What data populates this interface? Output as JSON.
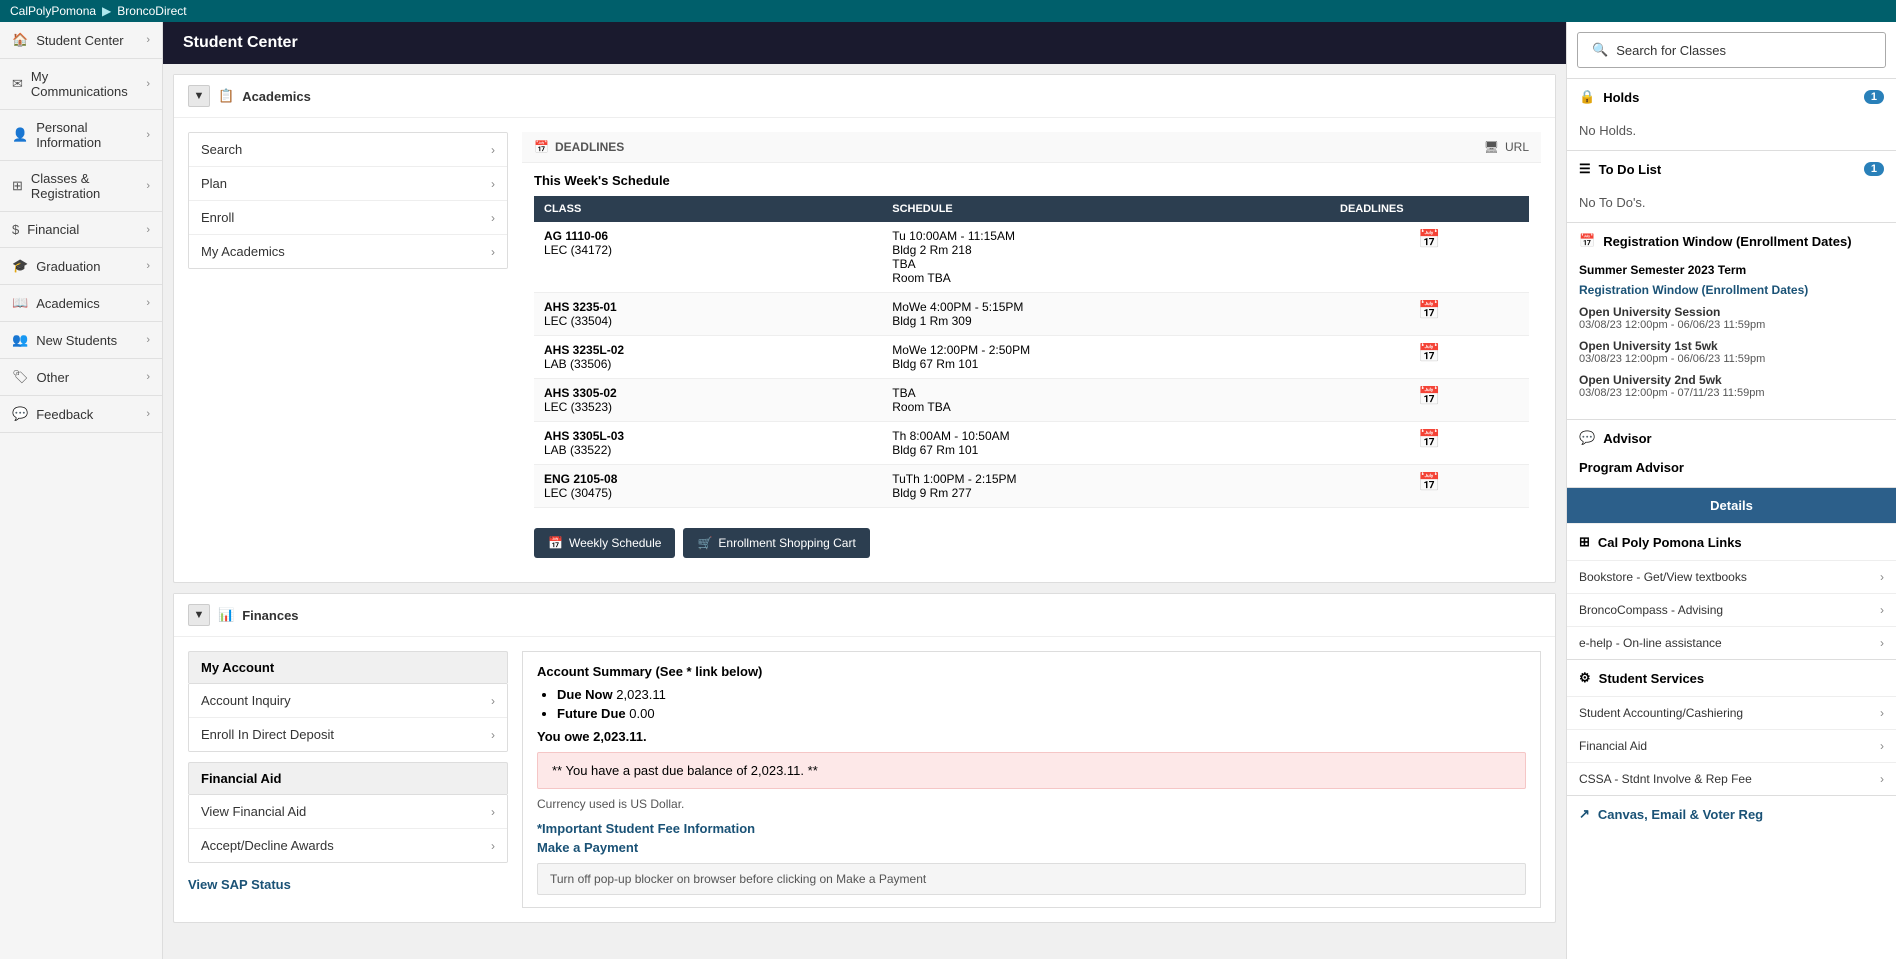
{
  "topbar": {
    "breadcrumb1": "CalPolyPomona",
    "breadcrumb2": "BroncoDirect"
  },
  "sidebar": {
    "items": [
      {
        "id": "student-center",
        "label": "Student Center",
        "icon": "home",
        "hasChildren": true
      },
      {
        "id": "my-communications",
        "label": "My Communications",
        "icon": "envelope",
        "hasChildren": true
      },
      {
        "id": "personal-information",
        "label": "Personal Information",
        "icon": "user",
        "hasChildren": true
      },
      {
        "id": "classes-registration",
        "label": "Classes & Registration",
        "icon": "grid",
        "hasChildren": true
      },
      {
        "id": "financial",
        "label": "Financial",
        "icon": "dollar",
        "hasChildren": true
      },
      {
        "id": "graduation",
        "label": "Graduation",
        "icon": "mortarboard",
        "hasChildren": true
      },
      {
        "id": "academics",
        "label": "Academics",
        "icon": "book",
        "hasChildren": true
      },
      {
        "id": "new-students",
        "label": "New Students",
        "icon": "users",
        "hasChildren": true
      },
      {
        "id": "other",
        "label": "Other",
        "icon": "tag",
        "hasChildren": true
      },
      {
        "id": "feedback",
        "label": "Feedback",
        "icon": "comment",
        "hasChildren": true
      }
    ]
  },
  "pageHeader": "Student Center",
  "academics": {
    "sectionLabel": "Academics",
    "menuItems": [
      {
        "label": "Search",
        "id": "search"
      },
      {
        "label": "Plan",
        "id": "plan"
      },
      {
        "label": "Enroll",
        "id": "enroll"
      },
      {
        "label": "My Academics",
        "id": "my-academics"
      }
    ],
    "deadlinesLabel": "DEADLINES",
    "urlLabel": "URL",
    "weekScheduleTitle": "This Week's Schedule",
    "tableHeaders": [
      "CLASS",
      "SCHEDULE",
      "DEADLINES"
    ],
    "classes": [
      {
        "code": "AG 1110-06",
        "section": "LEC (34172)",
        "schedule": "Tu 10:00AM - 11:15AM\nBldg 2 Rm 218\nTBA\nRoom TBA"
      },
      {
        "code": "AHS 3235-01",
        "section": "LEC (33504)",
        "schedule": "MoWe 4:00PM - 5:15PM\nBldg 1 Rm 309"
      },
      {
        "code": "AHS 3235L-02",
        "section": "LAB (33506)",
        "schedule": "MoWe 12:00PM - 2:50PM\nBldg 67 Rm 101"
      },
      {
        "code": "AHS 3305-02",
        "section": "LEC (33523)",
        "schedule": "TBA\nRoom TBA"
      },
      {
        "code": "AHS 3305L-03",
        "section": "LAB (33522)",
        "schedule": "Th 8:00AM - 10:50AM\nBldg 67 Rm 101"
      },
      {
        "code": "ENG 2105-08",
        "section": "LEC (30475)",
        "schedule": "TuTh 1:00PM - 2:15PM\nBldg 9 Rm 277"
      }
    ],
    "weeklyScheduleBtn": "Weekly Schedule",
    "enrollmentCartBtn": "Enrollment Shopping Cart"
  },
  "finances": {
    "sectionLabel": "Finances",
    "myAccountLabel": "My Account",
    "menuItems": [
      {
        "label": "Account Inquiry",
        "id": "account-inquiry"
      },
      {
        "label": "Enroll In Direct Deposit",
        "id": "direct-deposit"
      }
    ],
    "financialAidLabel": "Financial Aid",
    "financialAidItems": [
      {
        "label": "View Financial Aid",
        "id": "view-financial-aid"
      },
      {
        "label": "Accept/Decline Awards",
        "id": "accept-decline"
      }
    ],
    "viewSapLabel": "View SAP Status",
    "accountSummaryTitle": "Account Summary (See * link below)",
    "dueNowLabel": "Due Now",
    "dueNowAmount": "2,023.11",
    "futureDueLabel": "Future Due",
    "futureDueAmount": "0.00",
    "youOweText": "You owe 2,023.11.",
    "pastDueMessage": "** You have a past due balance of 2,023.11. **",
    "currencyNote": "Currency used is US Dollar.",
    "importantFeeLink": "*Important Student Fee Information",
    "makePaymentLink": "Make a Payment",
    "popupNote": "Turn off pop-up blocker on browser before clicking on Make a Payment",
    "accountLabel": "Account"
  },
  "rightPanel": {
    "searchClassesBtn": "Search for Classes",
    "holdsLabel": "Holds",
    "holdsBadge": "1",
    "noHoldsText": "No Holds.",
    "todoLabel": "To Do List",
    "todoBadge": "1",
    "noTodosText": "No To Do's.",
    "regWindowLabel": "Registration Window (Enrollment Dates)",
    "regWindowTerm": "Summer Semester 2023 Term",
    "regWindowLink": "Registration Window (Enrollment Dates)",
    "sessions": [
      {
        "name": "Open University Session",
        "dates": "03/08/23 12:00pm - 06/06/23 11:59pm"
      },
      {
        "name": "Open University 1st 5wk",
        "dates": "03/08/23 12:00pm - 06/06/23 11:59pm"
      },
      {
        "name": "Open University 2nd 5wk",
        "dates": "03/08/23 12:00pm - 07/11/23 11:59pm"
      }
    ],
    "advisorLabel": "Advisor",
    "advisorValue": "Program Advisor",
    "detailsLabel": "Details",
    "calPolyLinksLabel": "Cal Poly Pomona Links",
    "links": [
      {
        "label": "Bookstore - Get/View textbooks"
      },
      {
        "label": "BroncoCompass - Advising"
      },
      {
        "label": "e-help - On-line assistance"
      }
    ],
    "studentServicesLabel": "Student Services",
    "studentServicesLinks": [
      {
        "label": "Student Accounting/Cashiering"
      },
      {
        "label": "Financial Aid"
      },
      {
        "label": "CSSA - Stdnt Involve & Rep Fee"
      }
    ],
    "canvasLabel": "Canvas, Email & Voter Reg"
  }
}
